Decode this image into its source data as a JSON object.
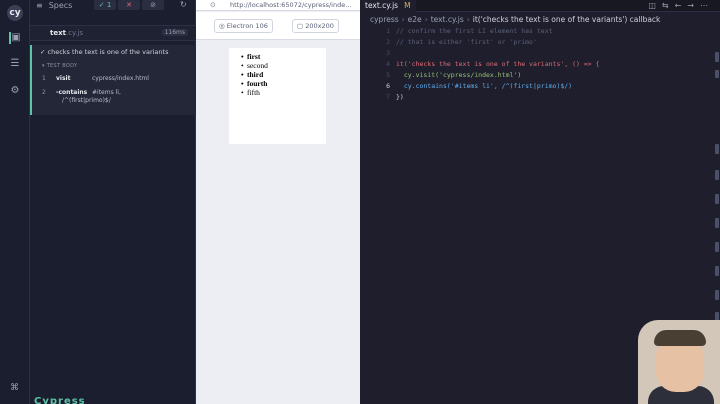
{
  "reporter": {
    "specs_label": "Specs",
    "stats": {
      "pass": "1",
      "fail": "✕",
      "pending": "⊘"
    },
    "spec_file": {
      "name": "text",
      "ext": ".cy.js",
      "duration": "116ms"
    },
    "test_title": "checks the text is one of the variants",
    "test_body_label": "TEST BODY",
    "commands": [
      {
        "num": "1",
        "name": "visit",
        "arg": "cypress/index.html"
      },
      {
        "num": "2",
        "name": "-contains",
        "arg": "#items li,",
        "arg2": "/^(first|primo)$/"
      }
    ],
    "brand": "Cypress"
  },
  "aut": {
    "url": "http://localhost:65072/cypress/inde...",
    "browser": "Electron 106",
    "viewport": "200x200",
    "items": [
      {
        "text": "first",
        "bold": true
      },
      {
        "text": "second",
        "bold": false
      },
      {
        "text": "third",
        "bold": true
      },
      {
        "text": "fourth",
        "bold": true
      },
      {
        "text": "fifth",
        "bold": false
      }
    ]
  },
  "editor": {
    "tab_name": "text.cy.js",
    "tab_modified": "M",
    "breadcrumbs": [
      "cypress",
      "e2e",
      "text.cy.js",
      "it('checks the text is one of the variants') callback"
    ],
    "lines": [
      {
        "num": "1",
        "text": "// confirm the first LI element has text"
      },
      {
        "num": "2",
        "text": "// that is either 'first' or 'primo'"
      },
      {
        "num": "3",
        "text": ""
      },
      {
        "num": "4",
        "text": "it('checks the text is one of the variants', () => {"
      },
      {
        "num": "5",
        "text": "  cy.visit('cypress/index.html')"
      },
      {
        "num": "6",
        "text": "  cy.contains('#items li', /^(first|primo)$/)"
      },
      {
        "num": "7",
        "text": "})"
      }
    ]
  }
}
